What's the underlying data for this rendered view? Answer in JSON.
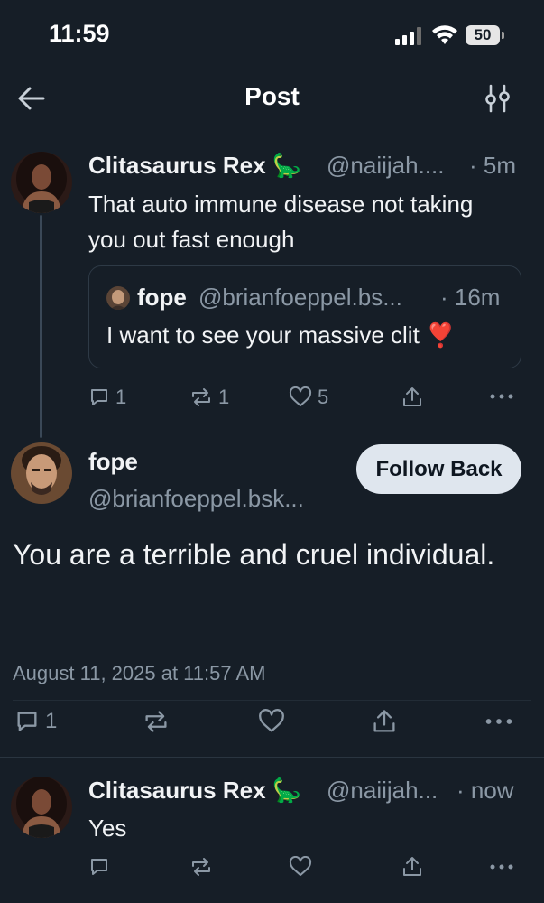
{
  "status_bar": {
    "time": "11:59",
    "battery": "50"
  },
  "header": {
    "title": "Post"
  },
  "parent_post": {
    "author_name": "Clitasaurus Rex 🦕",
    "handle": "@naiijah....",
    "age": "· 5m",
    "text": "That auto immune disease not taking you out fast enough",
    "quote": {
      "author_name": "fope",
      "handle": "@brianfoeppel.bs...",
      "age": "· 16m",
      "text": "I want to see your massive clit ❣️"
    },
    "replies": "1",
    "reposts": "1",
    "likes": "5"
  },
  "main_post": {
    "author_name": "fope",
    "handle": "@brianfoeppel.bsk...",
    "follow_label": "Follow Back",
    "text": "You are a terrible and cruel individual.",
    "timestamp": "August 11, 2025 at 11:57 AM",
    "replies": "1"
  },
  "reply_post": {
    "author_name": "Clitasaurus Rex 🦕",
    "handle": "@naiijah...",
    "age": "· now",
    "text": "Yes"
  },
  "colors": {
    "background": "#161e27",
    "muted": "#8b98a5",
    "button_bg": "#dfe6ee"
  }
}
